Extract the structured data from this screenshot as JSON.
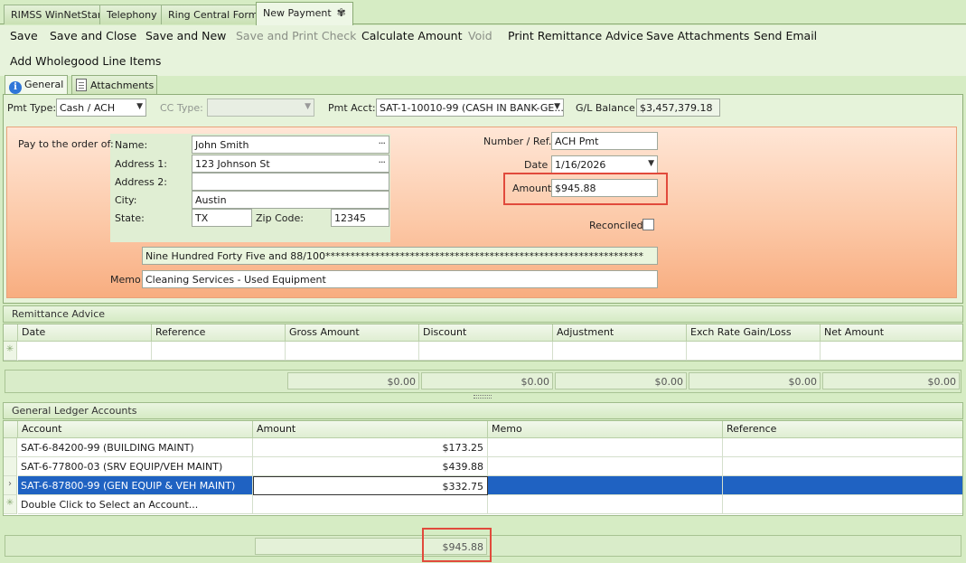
{
  "doc_tabs": [
    "RIMSS WinNetStar",
    "Telephony",
    "Ring Central Form",
    "New Payment"
  ],
  "toolbar": {
    "items": [
      "Save",
      "Save and Close",
      "Save and New",
      "Save and Print Check",
      "Calculate Amount",
      "Void",
      "Print Remittance Advice",
      "Save Attachments",
      "Send Email"
    ],
    "row2": "Add Wholegood Line Items"
  },
  "sub_tabs": [
    "General",
    "Attachments"
  ],
  "header": {
    "pmt_type_label": "Pmt Type:",
    "pmt_type_value": "Cash / ACH",
    "cc_type_label": "CC Type:",
    "cc_type_value": "",
    "pmt_acct_label": "Pmt Acct:",
    "pmt_acct_value": "SAT-1-10010-99 (CASH IN BANK-GE...",
    "gl_balance_label": "G/L Balance:",
    "gl_balance_value": "$3,457,379.18"
  },
  "payee": {
    "pay_to_label": "Pay to the order of:",
    "name_label": "Name:",
    "name_value": "John Smith",
    "address1_label": "Address 1:",
    "address1_value": "123 Johnson St",
    "address2_label": "Address 2:",
    "address2_value": "",
    "city_label": "City:",
    "city_value": "Austin",
    "state_label": "State:",
    "state_value": "TX",
    "zip_label": "Zip Code:",
    "zip_value": "12345",
    "amount_words": "Nine Hundred Forty Five and 88/100****************************************************************",
    "memo_label": "Memo",
    "memo_value": "Cleaning Services - Used Equipment"
  },
  "payment": {
    "number_ref_label": "Number / Ref.",
    "number_ref_value": "ACH Pmt",
    "date_label": "Date",
    "date_value": "1/16/2026",
    "amount_label": "Amount",
    "amount_value": "$945.88",
    "reconciled_label": "Reconciled",
    "reconciled_checked": false
  },
  "remittance": {
    "title": "Remittance Advice",
    "columns": [
      "Date",
      "Reference",
      "Gross Amount",
      "Discount",
      "Adjustment",
      "Exch Rate Gain/Loss",
      "Net Amount"
    ],
    "totals": [
      "$0.00",
      "$0.00",
      "$0.00",
      "$0.00",
      "$0.00"
    ]
  },
  "gl": {
    "title": "General Ledger Accounts",
    "columns": [
      "Account",
      "Amount",
      "Memo",
      "Reference"
    ],
    "rows": [
      {
        "account": "SAT-6-84200-99 (BUILDING MAINT)",
        "amount": "$173.25",
        "memo": "",
        "reference": ""
      },
      {
        "account": "SAT-6-77800-03 (SRV EQUIP/VEH MAINT)",
        "amount": "$439.88",
        "memo": "",
        "reference": ""
      },
      {
        "account": "SAT-6-87800-99 (GEN EQUIP & VEH MAINT)",
        "amount": "$332.75",
        "memo": "",
        "reference": ""
      }
    ],
    "new_row_text": "Double Click to Select an Account...",
    "total": "$945.88"
  },
  "colors": {
    "highlight": "#e14a3c",
    "selection": "#1f62c2",
    "panel_green": "#d6ecc4",
    "pay_area_orange": "#f8ad80"
  }
}
